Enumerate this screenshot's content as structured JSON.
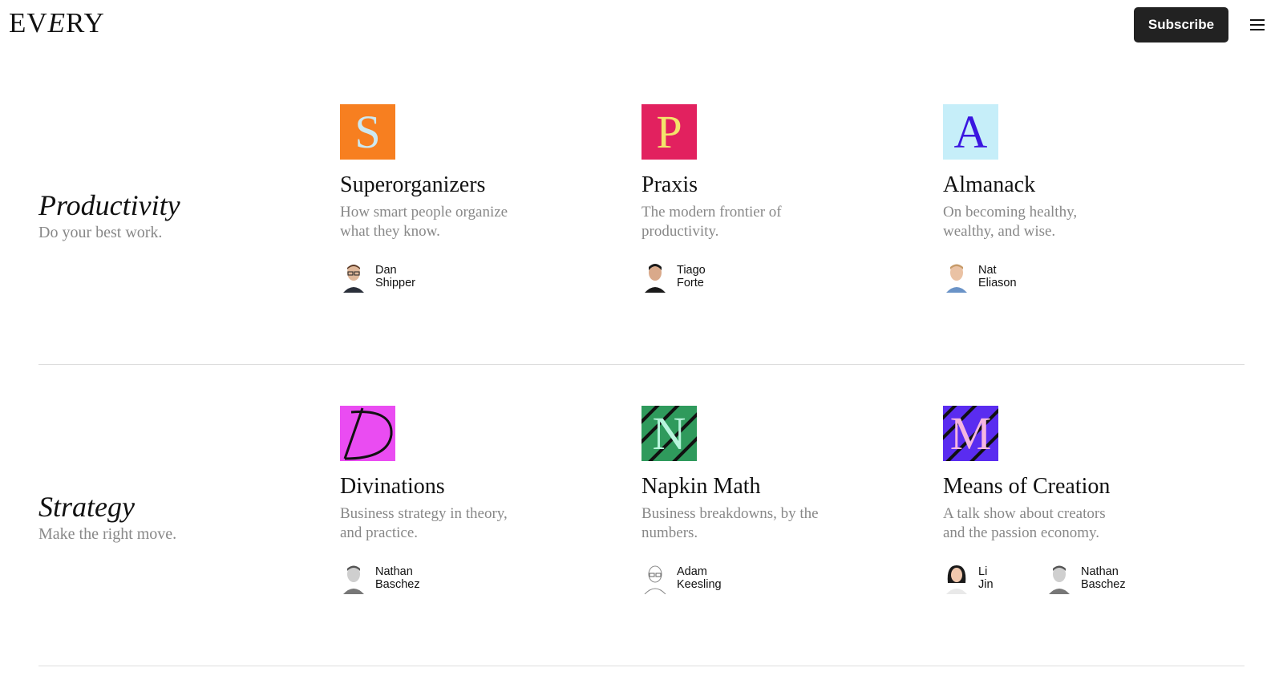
{
  "header": {
    "logo": "EVERY",
    "logo_parts": [
      "EV",
      "E",
      "RY"
    ],
    "subscribe_label": "Subscribe"
  },
  "sections": [
    {
      "title": "Productivity",
      "tagline": "Do your best work.",
      "cards": [
        {
          "badge_letter": "S",
          "badge_bg": "#f77f20",
          "badge_fg": "#cde8f0",
          "title": "Superorganizers",
          "desc": "How smart people organize what they know.",
          "authors": [
            {
              "first": "Dan",
              "last": "Shipper"
            }
          ]
        },
        {
          "badge_letter": "P",
          "badge_bg": "#e2215f",
          "badge_fg": "#f3e46b",
          "title": "Praxis",
          "desc": "The modern frontier of productivity.",
          "authors": [
            {
              "first": "Tiago",
              "last": "Forte"
            }
          ]
        },
        {
          "badge_letter": "A",
          "badge_bg": "#c6eef9",
          "badge_fg": "#3a16e0",
          "title": "Almanack",
          "desc": "On becoming healthy, wealthy, and wise.",
          "authors": [
            {
              "first": "Nat",
              "last": "Eliason"
            }
          ]
        }
      ]
    },
    {
      "title": "Strategy",
      "tagline": "Make the right move.",
      "cards": [
        {
          "badge_letter": "D",
          "badge_bg": "#ea4cf2",
          "badge_fg": "#111111",
          "title": "Divinations",
          "desc": "Business strategy in theory, and practice.",
          "authors": [
            {
              "first": "Nathan",
              "last": "Baschez"
            }
          ]
        },
        {
          "badge_letter": "N",
          "badge_bg": "#2f9a5c",
          "badge_fg": "#b8f5dc",
          "title": "Napkin Math",
          "desc": "Business breakdowns, by the numbers.",
          "authors": [
            {
              "first": "Adam",
              "last": "Keesling"
            }
          ]
        },
        {
          "badge_letter": "M",
          "badge_bg": "#5a2cf0",
          "badge_fg": "#f5b6e0",
          "title": "Means of Creation",
          "desc": "A talk show about creators and the passion economy.",
          "authors": [
            {
              "first": "Li",
              "last": "Jin"
            },
            {
              "first": "Nathan",
              "last": "Baschez"
            }
          ]
        }
      ]
    }
  ],
  "icons": {
    "menu": "hamburger-menu-icon",
    "avatar": "person-avatar-icon"
  }
}
